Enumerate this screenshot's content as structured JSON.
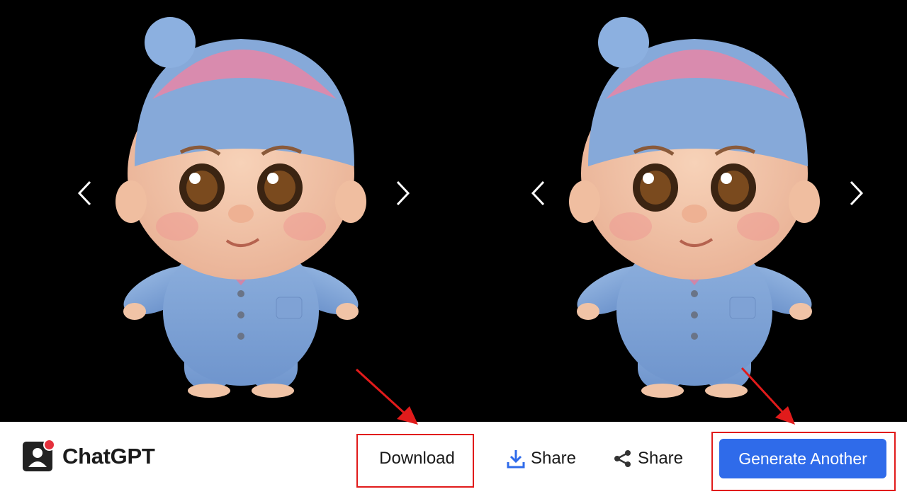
{
  "viewer": {
    "images": [
      {
        "name": "baby-left",
        "alt": ""
      },
      {
        "name": "baby-right",
        "alt": ""
      }
    ],
    "nav_icons": [
      "chevron-left-icon",
      "chevron-right-icon"
    ]
  },
  "footer": {
    "app_icon": "contact-card-icon",
    "app_name": "ChatGPT",
    "buttons": {
      "download": "Download",
      "share_download_icon": "Share",
      "share_nodes_icon": "Share",
      "generate": "Generate Another"
    },
    "colors": {
      "primary_button": "#2f6bea",
      "highlight": "#e11b1b",
      "badge": "#e5303c"
    }
  }
}
